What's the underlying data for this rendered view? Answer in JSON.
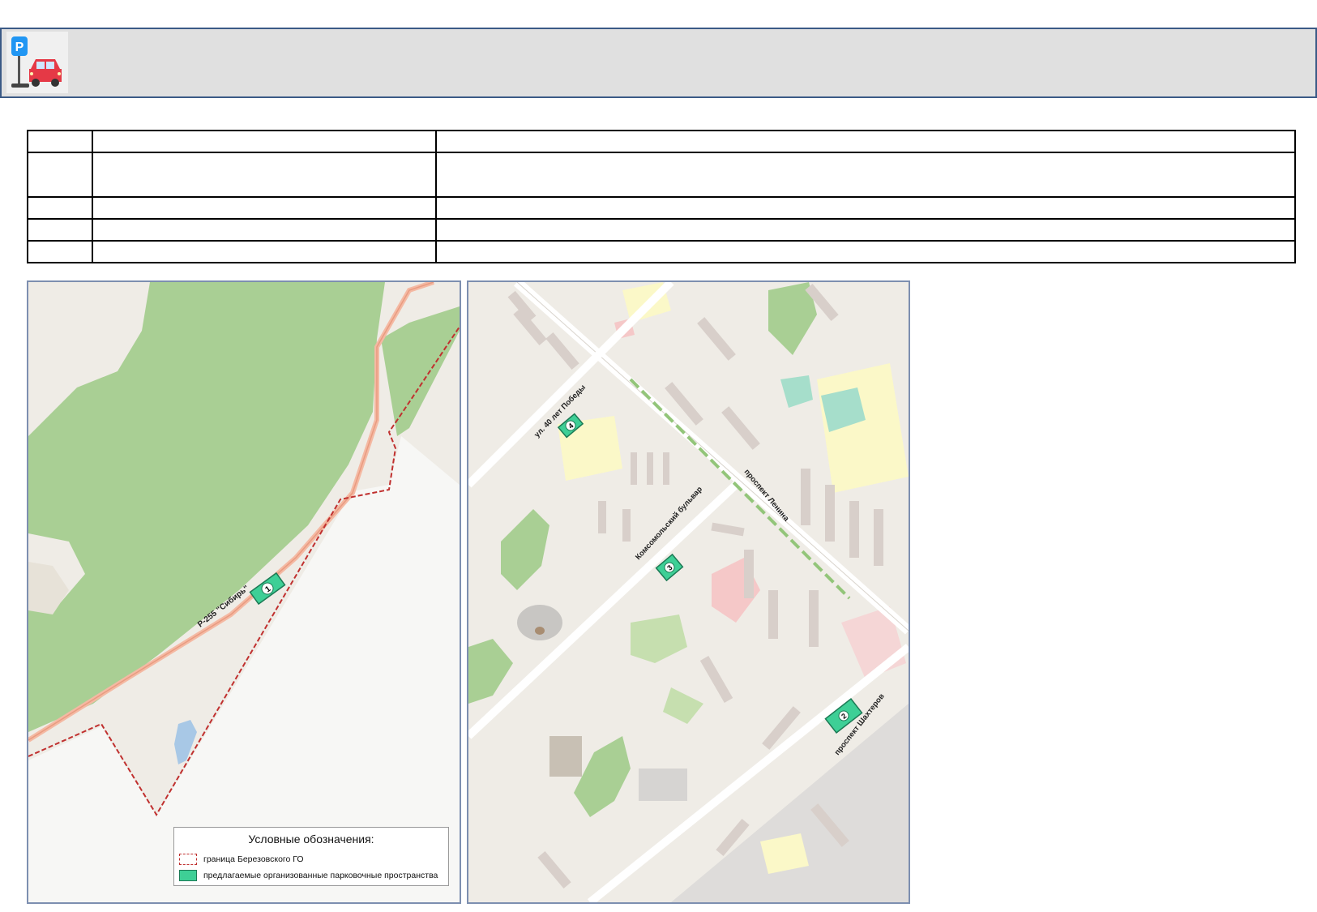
{
  "header": {
    "icon": "parking-car-icon"
  },
  "table": {
    "rows": [
      [
        "",
        "",
        ""
      ],
      [
        "",
        "",
        ""
      ],
      [
        "",
        "",
        ""
      ],
      [
        "",
        "",
        ""
      ],
      [
        "",
        "",
        ""
      ]
    ]
  },
  "map_left": {
    "road_label": "Р-255 \"Сибирь\"",
    "markers": [
      {
        "number": "1"
      }
    ]
  },
  "map_right": {
    "street_labels": {
      "victory": "ул. 40 лет Победы",
      "komsomol": "Комсомольский бульвар",
      "lenin": "проспект Ленина",
      "miners": "проспект Шахтеров"
    },
    "markers": [
      {
        "number": "4"
      },
      {
        "number": "3"
      },
      {
        "number": "2"
      }
    ]
  },
  "legend": {
    "title": "Условные обозначения:",
    "items": [
      {
        "label": "граница Березовского ГО",
        "color": "#c0302f"
      },
      {
        "label": "предлагаемые организованные парковочные пространства",
        "color": "#3ecf96"
      }
    ]
  },
  "colors": {
    "header_border": "#3b5a86",
    "header_bg": "#e0e0e0",
    "forest": "#a9cf94",
    "parking": "#3ecf96",
    "boundary": "#c0302f"
  }
}
